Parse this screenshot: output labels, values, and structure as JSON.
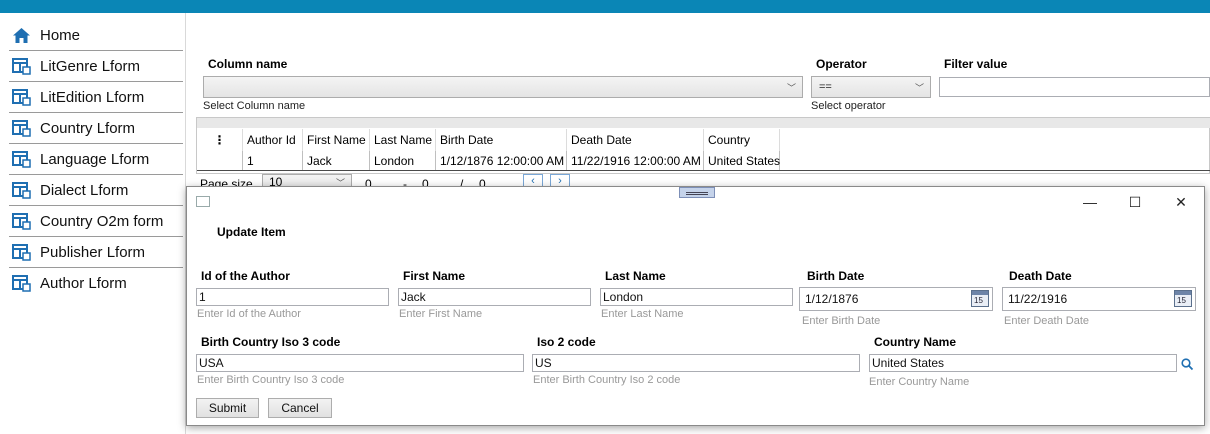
{
  "sidebar": {
    "items": [
      {
        "label": "Home",
        "icon": "home-icon"
      },
      {
        "label": "LitGenre Lform",
        "icon": "form-icon"
      },
      {
        "label": "LitEdition Lform",
        "icon": "form-icon"
      },
      {
        "label": "Country Lform",
        "icon": "form-icon"
      },
      {
        "label": "Language Lform",
        "icon": "form-icon"
      },
      {
        "label": "Dialect Lform",
        "icon": "form-icon"
      },
      {
        "label": "Country O2m form",
        "icon": "form-icon"
      },
      {
        "label": "Publisher Lform",
        "icon": "form-icon"
      },
      {
        "label": "Author Lform",
        "icon": "form-icon"
      }
    ]
  },
  "filter": {
    "column_label": "Column name",
    "column_hint": "Select Column name",
    "operator_label": "Operator",
    "operator_value": "==",
    "operator_hint": "Select operator",
    "value_label": "Filter value"
  },
  "grid": {
    "columns": [
      "Author Id",
      "First Name",
      "Last Name",
      "Birth Date",
      "Death Date",
      "Country"
    ],
    "rows": [
      [
        "1",
        "Jack",
        "London",
        "1/12/1876 12:00:00 AM",
        "11/22/1916 12:00:00 AM",
        "United States"
      ]
    ]
  },
  "pager": {
    "label": "Page size",
    "size": "10",
    "start": "0",
    "dash": "-",
    "end": "0",
    "slash": "/",
    "total": "0"
  },
  "dialog": {
    "title": "Update Item",
    "fields": {
      "id": {
        "label": "Id of the Author",
        "value": "1",
        "hint": "Enter Id of the Author"
      },
      "first": {
        "label": "First Name",
        "value": "Jack",
        "hint": "Enter First Name"
      },
      "last": {
        "label": "Last Name",
        "value": "London",
        "hint": "Enter Last Name"
      },
      "birth": {
        "label": "Birth Date",
        "value": "1/12/1876",
        "hint": "Enter Birth Date"
      },
      "death": {
        "label": "Death Date",
        "value": "11/22/1916",
        "hint": "Enter Death Date"
      },
      "iso3": {
        "label": "Birth Country Iso 3 code",
        "value": "USA",
        "hint": "Enter Birth Country Iso 3 code"
      },
      "iso2": {
        "label": "Iso 2 code",
        "value": "US",
        "hint": "Enter Birth Country Iso 2 code"
      },
      "country": {
        "label": "Country Name",
        "value": "United States",
        "hint": "Enter Country Name"
      }
    },
    "calendar_day": "15",
    "submit_label": "Submit",
    "cancel_label": "Cancel",
    "minimize_glyph": "—",
    "maximize_glyph": "☐",
    "close_glyph": "✕"
  },
  "colors": {
    "accent": "#0a86b6",
    "icon_blue": "#1f6fb2"
  }
}
